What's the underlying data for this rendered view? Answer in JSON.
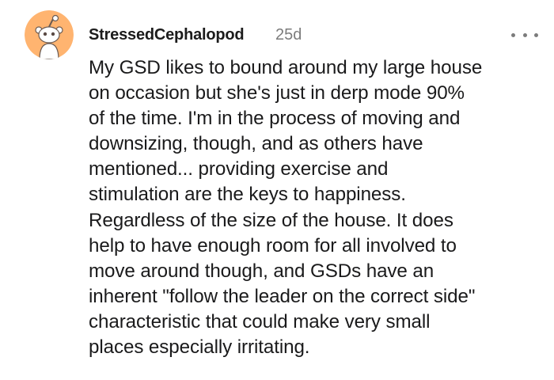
{
  "comment": {
    "avatar_icon": "reddit-snoo-avatar-icon",
    "avatar_bg_color": "#ffb470",
    "username": "StressedCephalopod",
    "timestamp": "25d",
    "more_icon": "more-options-icon",
    "body_lines": [
      "My GSD likes to bound around my large house",
      "on occasion but she's just in derp mode 90%",
      "of the time. I'm in the process of moving and",
      "downsizing, though, and as others have",
      "mentioned... providing exercise and",
      "stimulation are the keys to happiness.",
      "Regardless of the size of the house. It does",
      "help to have enough room for all involved to",
      "move around though, and GSDs have an",
      "inherent \"follow the leader on the correct side\"",
      "characteristic that could make very small",
      "places especially irritating."
    ]
  }
}
